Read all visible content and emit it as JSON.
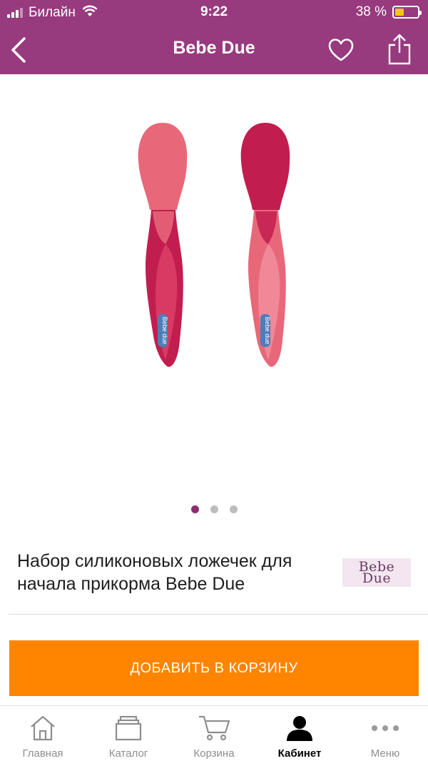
{
  "status_bar": {
    "carrier": "Билайн",
    "time": "9:22",
    "battery_percent": "38 %",
    "battery_level": 0.38,
    "icons": [
      "signal-icon",
      "wifi-icon",
      "battery-icon"
    ]
  },
  "header": {
    "title": "Bebe Due",
    "background_color": "#973a7e",
    "icons": [
      "back-chevron-icon",
      "heart-icon",
      "share-icon"
    ]
  },
  "gallery": {
    "image_count": 3,
    "active_index": 0,
    "image_label": "Bebe due",
    "colors": {
      "light_spoon": "#e8687a",
      "dark_spoon": "#c21d4f",
      "dot_active": "#8e2b72",
      "dot_inactive": "#bdbdbd"
    }
  },
  "product": {
    "title": "Набор силиконовых ложечек для начала прикорма Bebe Due",
    "brand_logo_line1": "Bebe",
    "brand_logo_line2": "Due"
  },
  "add_to_cart": {
    "label": "ДОБАВИТЬ В КОРЗИНУ",
    "color": "#ff8400"
  },
  "tab_bar": {
    "active": "Кабинет",
    "tabs": [
      {
        "label": "Главная",
        "icon": "home-icon"
      },
      {
        "label": "Каталог",
        "icon": "catalog-icon"
      },
      {
        "label": "Корзина",
        "icon": "cart-icon"
      },
      {
        "label": "Кабинет",
        "icon": "profile-icon"
      },
      {
        "label": "Меню",
        "icon": "more-icon"
      }
    ]
  }
}
